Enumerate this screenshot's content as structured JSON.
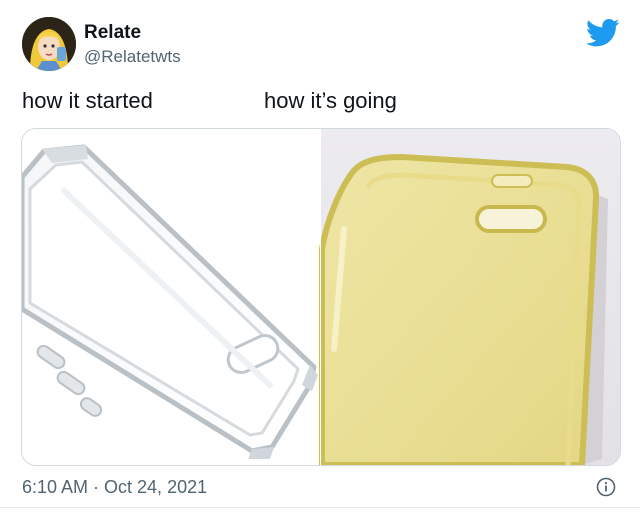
{
  "tweet": {
    "display_name": "Relate",
    "handle": "@Relatetwts",
    "caption_left": "how it started",
    "caption_right": "how it’s going",
    "timestamp": "6:10 AM · Oct 24, 2021"
  },
  "icons": {
    "brand": "twitter-bird-icon",
    "info": "info-icon"
  },
  "colors": {
    "brand_blue": "#1d9bf0",
    "text_primary": "#0f1419",
    "text_secondary": "#536471",
    "case_clear": "#c8ced4",
    "case_yellow": "#e8dc8a"
  }
}
